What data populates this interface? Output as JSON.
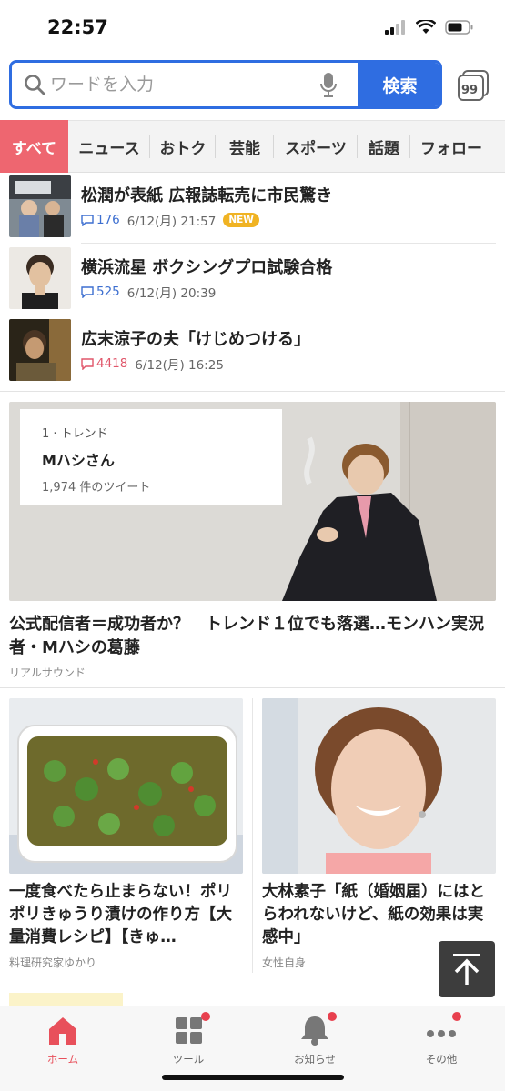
{
  "status_bar": {
    "time": "22:57"
  },
  "search": {
    "placeholder": "ワードを入力",
    "button_label": "検索",
    "quote_button": "99"
  },
  "tabs": [
    {
      "label": "すべて",
      "active": true
    },
    {
      "label": "ニュース"
    },
    {
      "label": "おトク"
    },
    {
      "label": "芸能"
    },
    {
      "label": "スポーツ"
    },
    {
      "label": "話題"
    },
    {
      "label": "フォロー"
    }
  ],
  "news": [
    {
      "title": "松潤が表紙 広報誌転売に市民驚き",
      "comments": "176",
      "date": "6/12(月) 21:57",
      "badge": "NEW",
      "hot": false
    },
    {
      "title": "横浜流星 ボクシングプロ試験合格",
      "comments": "525",
      "date": "6/12(月) 20:39",
      "hot": false
    },
    {
      "title": "広末涼子の夫「けじめつける」",
      "comments": "4418",
      "date": "6/12(月) 16:25",
      "hot": true
    }
  ],
  "feature": {
    "overlay": {
      "rank": "1 · トレンド",
      "name": "Mハシさん",
      "tweets": "1,974 件のツイート"
    },
    "title": "公式配信者＝成功者か？　トレンド１位でも落選…モンハン実況者・Mハシの葛藤",
    "source": "リアルサウンド"
  },
  "cards": [
    {
      "title": "一度食べたら止まらない！ポリポリきゅうり漬けの作り方【大量消費レシピ】【きゅ…",
      "source": "料理研究家ゆかり"
    },
    {
      "title": "大林素子「紙（婚姻届）にはとらわれないけど、紙の効果は実感中」",
      "source": "女性自身"
    }
  ],
  "bottom_nav": [
    {
      "label": "ホーム",
      "icon": "home-icon",
      "active": true
    },
    {
      "label": "ツール",
      "icon": "grid-icon",
      "dot": true
    },
    {
      "label": "お知らせ",
      "icon": "bell-icon",
      "dot": true
    },
    {
      "label": "その他",
      "icon": "more-icon",
      "dot": true
    }
  ],
  "colors": {
    "accent": "#2f6de1",
    "tab_active": "#ee6670",
    "badge_new": "#f0b323",
    "nav_active": "#e8505b"
  }
}
